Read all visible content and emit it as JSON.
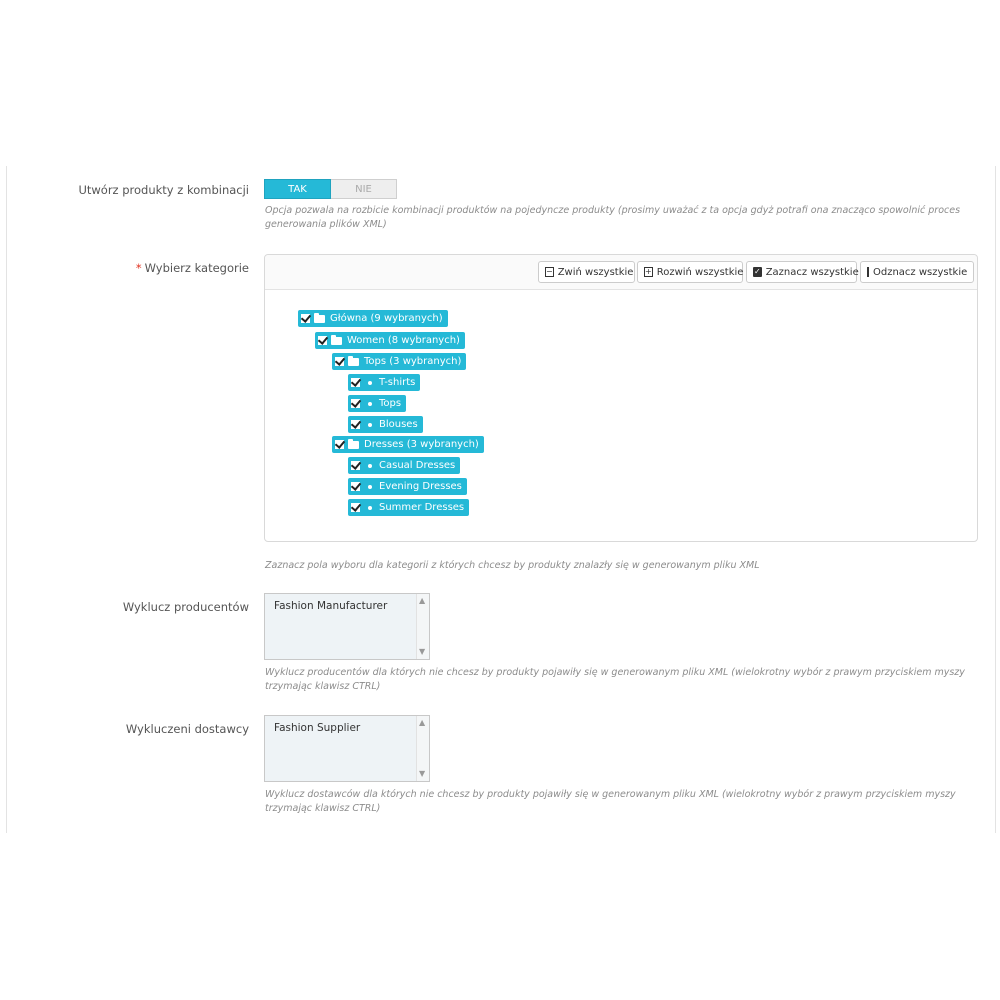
{
  "combinations": {
    "label": "Utwórz produkty z kombinacji",
    "yes": "TAK",
    "no": "NIE",
    "help": "Opcja pozwala na rozbicie kombinacji produktów na pojedyncze produkty (prosimy uważać z ta opcja gdyż potrafi ona znacząco spowolnić proces generowania plików XML)"
  },
  "categories": {
    "required_mark": "*",
    "label": "Wybierz kategorie",
    "toolbar": {
      "collapse_all": "Zwiń wszystkie",
      "expand_all": "Rozwiń wszystkie",
      "check_all": "Zaznacz wszystkie",
      "uncheck_all": "Odznacz wszystkie"
    },
    "tree": [
      {
        "label": "Główna (9 wybranych)",
        "kind": "folder"
      },
      {
        "label": "Women (8 wybranych)",
        "kind": "folder"
      },
      {
        "label": "Tops (3 wybranych)",
        "kind": "folder"
      },
      {
        "label": "T-shirts",
        "kind": "leaf"
      },
      {
        "label": "Tops",
        "kind": "leaf"
      },
      {
        "label": "Blouses",
        "kind": "leaf"
      },
      {
        "label": "Dresses (3 wybranych)",
        "kind": "folder"
      },
      {
        "label": "Casual Dresses",
        "kind": "leaf"
      },
      {
        "label": "Evening Dresses",
        "kind": "leaf"
      },
      {
        "label": "Summer Dresses",
        "kind": "leaf"
      }
    ],
    "help": "Zaznacz pola wyboru dla kategorii z których chcesz by produkty znalazły się w generowanym pliku XML"
  },
  "manufacturers": {
    "label": "Wyklucz producentów",
    "options": [
      "Fashion Manufacturer"
    ],
    "help": "Wyklucz producentów dla których nie chcesz by produkty pojawiły się w generowanym pliku XML (wielokrotny wybór z prawym przyciskiem myszy trzymając klawisz CTRL)"
  },
  "suppliers": {
    "label": "Wykluczeni dostawcy",
    "options": [
      "Fashion Supplier"
    ],
    "help": "Wyklucz dostawców dla których nie chcesz by produkty pojawiły się w generowanym pliku XML (wielokrotny wybór z prawym przyciskiem myszy trzymając klawisz CTRL)"
  },
  "colors": {
    "accent": "#25b9d7"
  }
}
